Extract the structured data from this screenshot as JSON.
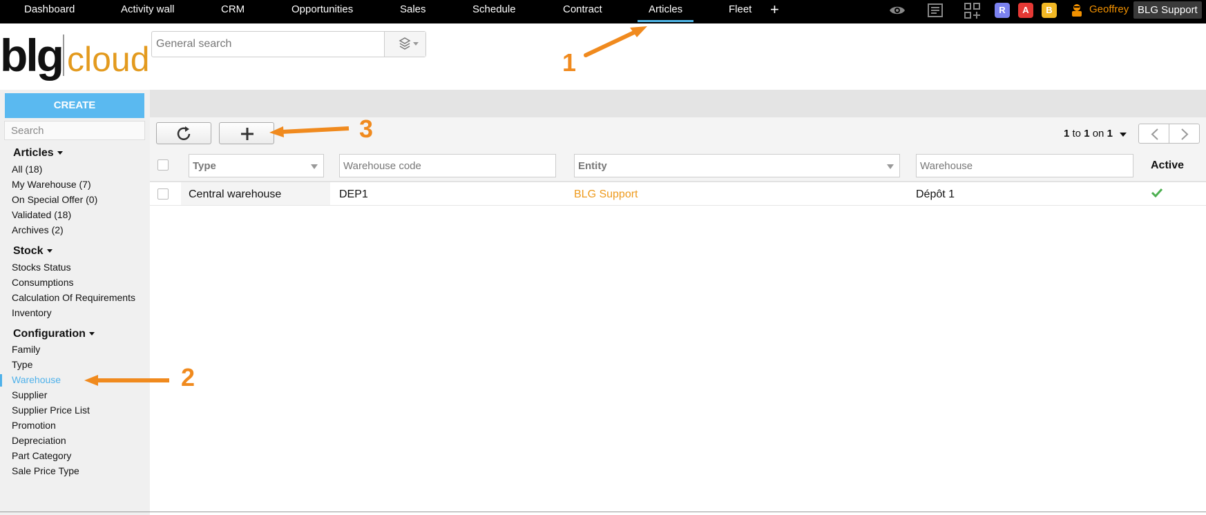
{
  "nav": {
    "items": [
      "Dashboard",
      "Activity wall",
      "CRM",
      "Opportunities",
      "Sales",
      "Schedule",
      "Contract",
      "Articles",
      "Fleet"
    ],
    "active": "Articles",
    "plus_label": "+"
  },
  "topbar": {
    "badges": [
      {
        "label": "R",
        "color": "#7b82f0"
      },
      {
        "label": "A",
        "color": "#e53935"
      },
      {
        "label": "B",
        "color": "#f2b824"
      }
    ],
    "user_name": "Geoffrey",
    "company": "BLG Support",
    "icons": [
      "eye-icon",
      "newspaper-icon",
      "apps-add-icon"
    ]
  },
  "logo": {
    "left": "blg",
    "right": "cloud"
  },
  "search": {
    "placeholder": "General search",
    "icon": "layers-icon"
  },
  "sidebar": {
    "create_label": "CREATE",
    "search_placeholder": "Search",
    "sections": [
      {
        "title": "Articles",
        "items": [
          "All (18)",
          "My Warehouse (7)",
          "On Special Offer (0)",
          "Validated (18)",
          "Archives (2)"
        ]
      },
      {
        "title": "Stock",
        "items": [
          "Stocks Status",
          "Consumptions",
          "Calculation Of Requirements",
          "Inventory"
        ]
      },
      {
        "title": "Configuration",
        "items": [
          "Family",
          "Type",
          "Warehouse",
          "Supplier",
          "Supplier Price List",
          "Promotion",
          "Depreciation",
          "Part Category",
          "Sale Price Type"
        ]
      }
    ],
    "active_item": "Warehouse"
  },
  "toolbar": {
    "refresh_icon": "refresh-icon",
    "add_icon": "plus-icon",
    "pager": {
      "from": "1",
      "to_word": "to",
      "to": "1",
      "on_word": "on",
      "total": "1"
    }
  },
  "table": {
    "filters": {
      "type_label": "Type",
      "warehouse_code_placeholder": "Warehouse code",
      "entity_label": "Entity",
      "warehouse_placeholder": "Warehouse",
      "active_header": "Active"
    },
    "rows": [
      {
        "type": "Central warehouse",
        "code": "DEP1",
        "entity": "BLG Support",
        "warehouse": "Dépôt 1",
        "active": true
      }
    ]
  },
  "annotations": [
    {
      "number": "1",
      "color": "#f08a1e"
    },
    {
      "number": "2",
      "color": "#f08a1e"
    },
    {
      "number": "3",
      "color": "#f08a1e"
    }
  ]
}
